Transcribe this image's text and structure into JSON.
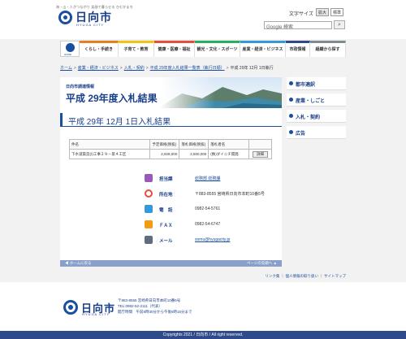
{
  "header": {
    "tagline": "海・山・人がつながり 笑顔で暮らせる ひむかまち",
    "logo_text": "日向市",
    "logo_sub": "HYUGA CITY",
    "fontsize_label": "文字サイズ",
    "fontsize_large": "拡大",
    "fontsize_standard": "標準",
    "search_placeholder": "Google 検索"
  },
  "gnav": {
    "home_label": "HOME",
    "items": [
      {
        "label": "くらし・手続き",
        "color": "#e67e22"
      },
      {
        "label": "子育て・教育",
        "color": "#f1c40f"
      },
      {
        "label": "健康・医療・福祉",
        "color": "#e74c3c"
      },
      {
        "label": "観光・文化・スポーツ",
        "color": "#27ae60"
      },
      {
        "label": "産業・経済・ビジネス",
        "color": "#3498db"
      },
      {
        "label": "市政情報",
        "color": "#2e4a8a"
      },
      {
        "label": "組織から探す",
        "color": "#7f8c8d"
      }
    ]
  },
  "breadcrumb": {
    "items": [
      "ホーム",
      "産業・経済・ビジネス",
      "入札・契約",
      "平成 29年度入札結果一覧表（執行日順）"
    ],
    "current": "平成 29年 12月 1日執行"
  },
  "banner": {
    "subtitle": "日向市調達情報",
    "title": "平成 29年度入札結果"
  },
  "page_title": "平成 29年 12月 1日入札結果",
  "table": {
    "headers": [
      "件名",
      "予定価格(税抜)",
      "落札価格(税抜)",
      "落札者名",
      ""
    ],
    "rows": [
      {
        "name": "下水道築造(Ⅰ)工事２９－第４工区",
        "planned": "2,928,000",
        "winning": "2,500,000",
        "winner": "(株)ダイニチ開発",
        "detail": "詳細"
      }
    ]
  },
  "contact": {
    "rows": [
      {
        "label": "担当課",
        "value": "総務部 総務課",
        "is_link": true,
        "icon": "person-icon",
        "color": "#9b59b6"
      },
      {
        "label": "所在地",
        "value": "〒883-8555 宮崎県日向市本町10番5号",
        "is_link": false,
        "icon": "map-pin-icon",
        "color": "#e74c3c"
      },
      {
        "label": "電　話",
        "value": "0982-54-5761",
        "is_link": false,
        "icon": "phone-icon",
        "color": "#3498db"
      },
      {
        "label": "ＦＡＸ",
        "value": "0982-54-6747",
        "is_link": false,
        "icon": "fax-icon",
        "color": "#f39c12"
      },
      {
        "label": "メール",
        "value": "somu@hyugacity.jp",
        "is_link": true,
        "icon": "mail-icon",
        "color": "#5d6d7e"
      }
    ]
  },
  "pagebar": {
    "home": "◀ ホームに戻る",
    "top": "ページの先頭へ ▲"
  },
  "side": {
    "items": [
      "都市適訳",
      "産業・しごと",
      "入札・契約",
      "広告"
    ]
  },
  "footer": {
    "links": [
      "リンク集",
      "個人情報の取り扱い",
      "サイトマップ"
    ],
    "logo_text": "日向市",
    "logo_sub": "HYUGA CITY",
    "address_lines": [
      "〒883-8555 宮崎県日向市本町10番5号",
      "TEL:0982-52-2111（代表）",
      "開庁時間　午前8時30分から午後5時15分まで"
    ],
    "copyright": "Copyrights 2021 / 日向市 / All right reserved."
  }
}
